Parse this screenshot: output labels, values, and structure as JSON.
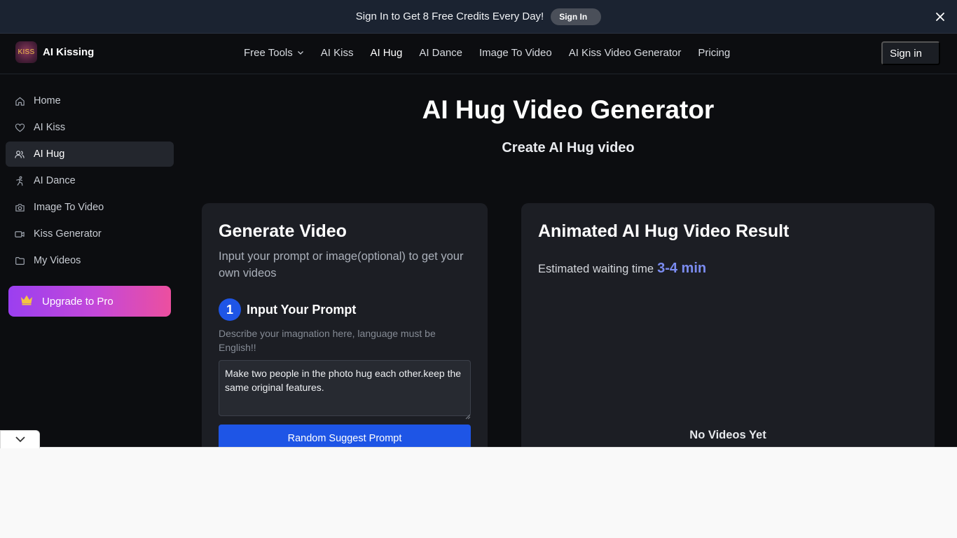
{
  "banner": {
    "text": "Sign In to Get 8 Free Credits Every Day!",
    "button_label": "Sign In"
  },
  "brand": {
    "logo_text": "KISS",
    "name": "AI Kissing"
  },
  "nav": {
    "links": [
      {
        "label": "Free Tools",
        "has_dropdown": true
      },
      {
        "label": "AI Kiss"
      },
      {
        "label": "AI Hug",
        "active": true
      },
      {
        "label": "AI Dance"
      },
      {
        "label": "Image To Video"
      },
      {
        "label": "AI Kiss Video Generator"
      },
      {
        "label": "Pricing"
      }
    ],
    "signin_label": "Sign in"
  },
  "sidebar": {
    "items": [
      {
        "label": "Home",
        "icon": "home-icon"
      },
      {
        "label": "AI Kiss",
        "icon": "heart-icon"
      },
      {
        "label": "AI Hug",
        "icon": "users-icon",
        "active": true
      },
      {
        "label": "AI Dance",
        "icon": "dance-icon"
      },
      {
        "label": "Image To Video",
        "icon": "camera-icon"
      },
      {
        "label": "Kiss Generator",
        "icon": "video-icon"
      },
      {
        "label": "My Videos",
        "icon": "folder-icon"
      }
    ],
    "upgrade_label": "Upgrade to Pro"
  },
  "main": {
    "title": "AI Hug Video Generator",
    "subtitle": "Create AI Hug video"
  },
  "generate_panel": {
    "title": "Generate Video",
    "description": "Input your prompt or image(optional) to get your own videos",
    "step_number": "1",
    "step_label": "Input Your Prompt",
    "step_hint": "Describe your imagnation here, language must be English!!",
    "prompt_value": "Make two people in the photo hug each other.keep the same original features.",
    "random_button_label": "Random Suggest Prompt"
  },
  "result_panel": {
    "title": "Animated AI Hug Video Result",
    "wait_label": "Estimated waiting time",
    "wait_value": "3-4 min",
    "empty_text": "No Videos Yet"
  },
  "colors": {
    "accent_blue": "#1e55e6",
    "wait_highlight": "#7b8cf0",
    "upgrade_gradient_start": "#9b3ff0",
    "upgrade_gradient_end": "#ec4f9f"
  }
}
